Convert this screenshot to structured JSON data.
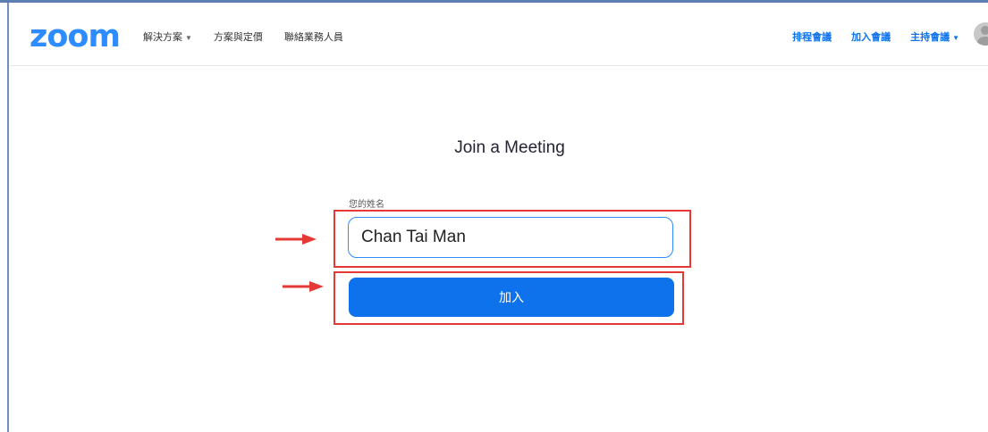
{
  "navbar": {
    "logo": "zoom",
    "left_items": [
      {
        "label": "解決方案",
        "has_caret": true
      },
      {
        "label": "方案與定價",
        "has_caret": false
      },
      {
        "label": "聯絡業務人員",
        "has_caret": false
      }
    ],
    "right_items": [
      {
        "label": "排程會議",
        "has_caret": false
      },
      {
        "label": "加入會議",
        "has_caret": false
      },
      {
        "label": "主持會議",
        "has_caret": true
      }
    ],
    "caret_glyph": "▼"
  },
  "main": {
    "title": "Join a Meeting",
    "name_label": "您的姓名",
    "name_value": "Chan Tai Man",
    "join_button": "加入"
  },
  "annotations": {
    "highlight_color": "#e53935",
    "arrow_color": "#e53935"
  },
  "colors": {
    "brand": "#2d8cff",
    "button": "#0e72ed",
    "nav_link_blue": "#0e72ed"
  }
}
